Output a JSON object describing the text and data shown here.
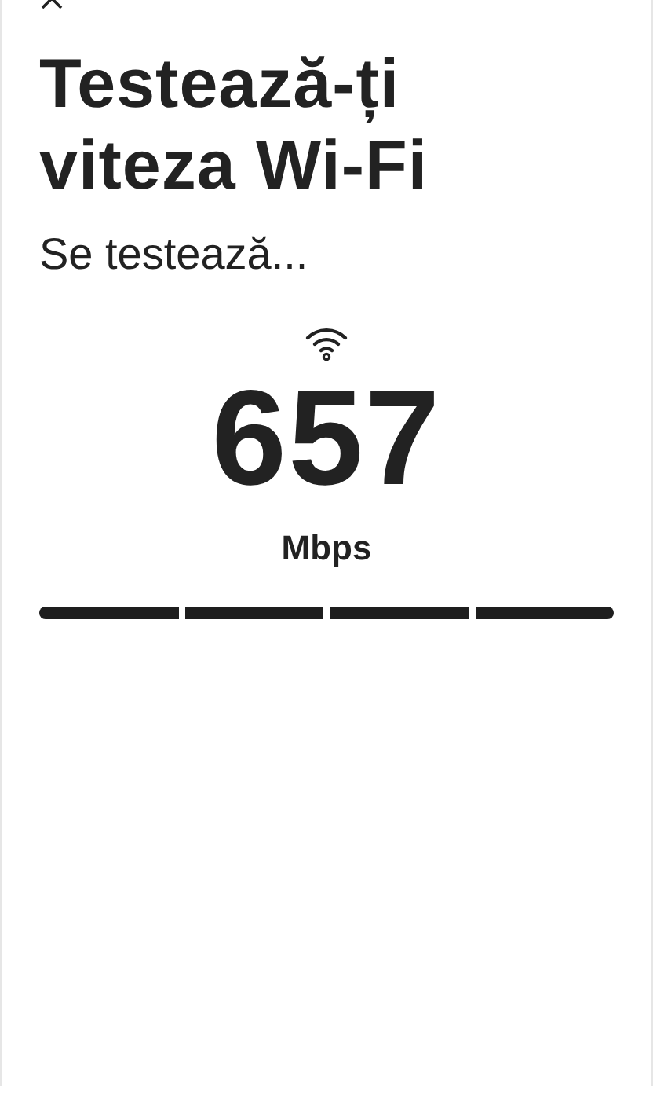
{
  "title": "Testează-ți viteza Wi-Fi",
  "status": "Se testează...",
  "speed": {
    "value": "657",
    "unit": "Mbps"
  },
  "progress": [
    {
      "level": 1
    },
    {
      "level": 1
    },
    {
      "level": 1
    },
    {
      "level": 1
    }
  ]
}
